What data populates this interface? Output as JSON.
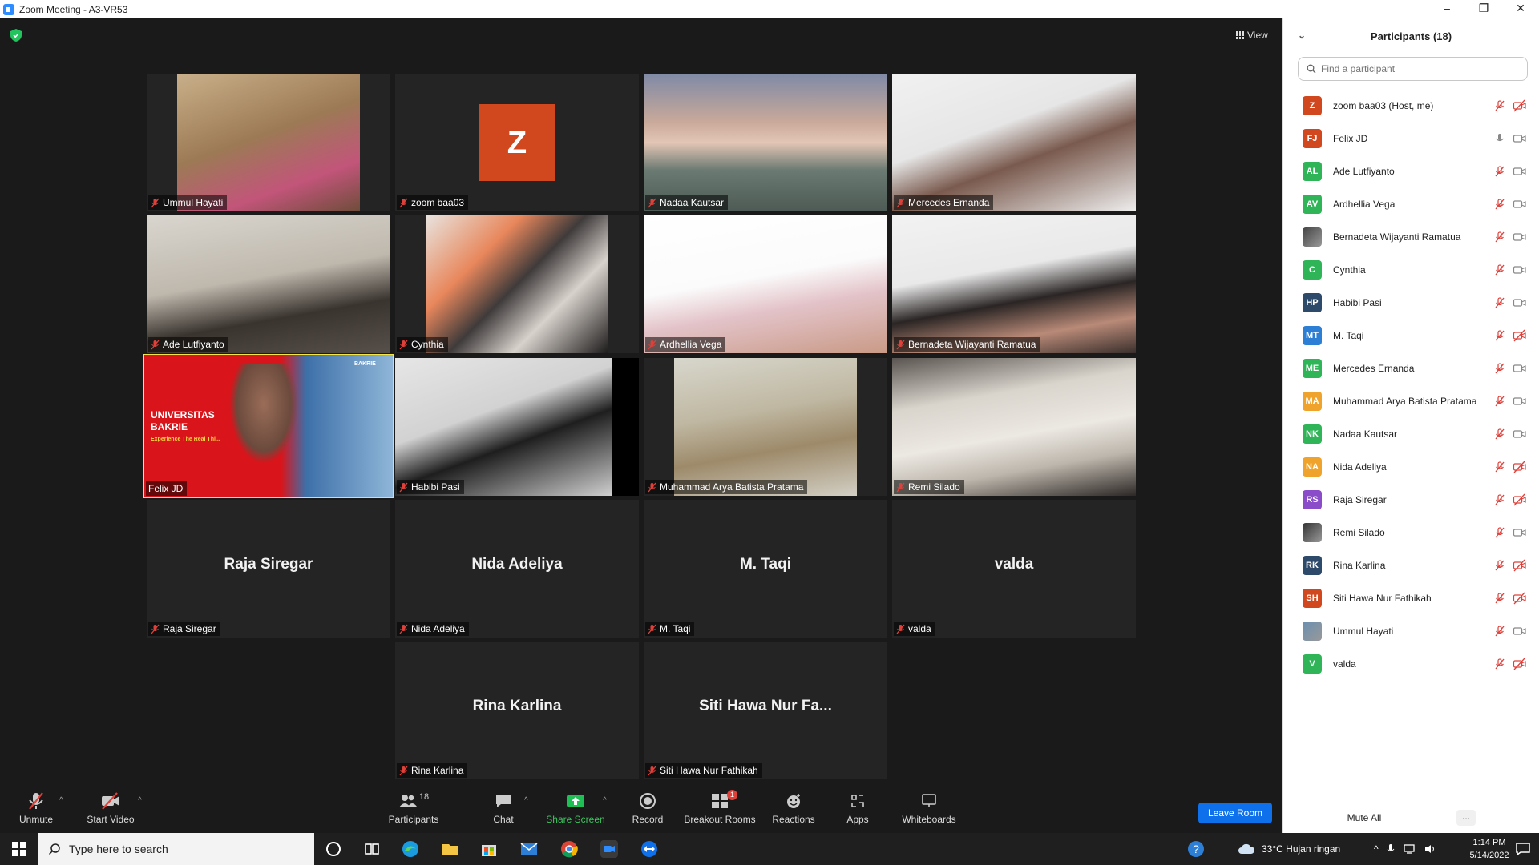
{
  "window": {
    "title": "Zoom Meeting - A3-VR53",
    "min": "–",
    "max": "❐",
    "close": "✕"
  },
  "view_label": "View",
  "tiles": [
    {
      "name": "Ummul Hayati",
      "video": true
    },
    {
      "name": "zoom baa03",
      "avatar_letter": "Z"
    },
    {
      "name": "Nadaa Kautsar",
      "video": true
    },
    {
      "name": "Mercedes Ernanda",
      "video": true
    },
    {
      "name": "Ade Lutfiyanto",
      "video": true
    },
    {
      "name": "Cynthia",
      "video": true
    },
    {
      "name": "Ardhellia Vega",
      "video": true
    },
    {
      "name": "Bernadeta Wijayanti Ramatua",
      "video": true
    },
    {
      "name": "Felix JD",
      "video": true,
      "active": true,
      "slide_title": "UNIVERSITAS BAKRIE",
      "slide_sub": "Experience The Real Thi...",
      "slide_logo": "BAKRIE"
    },
    {
      "name": "Habibi Pasi",
      "video": true
    },
    {
      "name": "Muhammad Arya Batista Pratama",
      "video": true
    },
    {
      "name": "Remi Silado",
      "video": true
    },
    {
      "name": "Raja Siregar",
      "display": "Raja Siregar"
    },
    {
      "name": "Nida Adeliya",
      "display": "Nida Adeliya"
    },
    {
      "name": "M. Taqi",
      "display": "M. Taqi"
    },
    {
      "name": "valda",
      "display": "valda"
    },
    {
      "name": "Rina Karlina",
      "display": "Rina Karlina"
    },
    {
      "name": "Siti Hawa Nur Fathikah",
      "display": "Siti Hawa Nur Fa..."
    }
  ],
  "toolbar": {
    "unmute": "Unmute",
    "start_video": "Start Video",
    "participants": "Participants",
    "participants_count": "18",
    "chat": "Chat",
    "share_screen": "Share Screen",
    "record": "Record",
    "breakout_rooms": "Breakout Rooms",
    "breakout_badge": "1",
    "reactions": "Reactions",
    "apps": "Apps",
    "whiteboards": "Whiteboards",
    "leave_room": "Leave Room"
  },
  "panel": {
    "title": "Participants (18)",
    "search_placeholder": "Find a participant",
    "mute_all": "Mute All",
    "more": "...",
    "participants": [
      {
        "initials": "Z",
        "name": "zoom baa03 (Host, me)",
        "color": "#d2481e",
        "mic": "off",
        "cam": "off"
      },
      {
        "initials": "FJ",
        "name": "Felix JD",
        "color": "#d2481e",
        "mic": "on",
        "cam": "on"
      },
      {
        "initials": "AL",
        "name": "Ade Lutfiyanto",
        "color": "#2fb457",
        "mic": "off",
        "cam": "on"
      },
      {
        "initials": "AV",
        "name": "Ardhellia Vega",
        "color": "#2fb457",
        "mic": "off",
        "cam": "on"
      },
      {
        "initials": "",
        "name": "Bernadeta Wijayanti Ramatua",
        "color": "#444444",
        "mic": "off",
        "cam": "on",
        "photo": true
      },
      {
        "initials": "C",
        "name": "Cynthia",
        "color": "#2fb457",
        "mic": "off",
        "cam": "on"
      },
      {
        "initials": "HP",
        "name": "Habibi Pasi",
        "color": "#2e4a6b",
        "mic": "off",
        "cam": "on"
      },
      {
        "initials": "MT",
        "name": "M. Taqi",
        "color": "#2d7fd6",
        "mic": "off",
        "cam": "off"
      },
      {
        "initials": "ME",
        "name": "Mercedes Ernanda",
        "color": "#2fb457",
        "mic": "off",
        "cam": "on"
      },
      {
        "initials": "MA",
        "name": "Muhammad Arya Batista Pratama",
        "color": "#f0a32c",
        "mic": "off",
        "cam": "on"
      },
      {
        "initials": "NK",
        "name": "Nadaa Kautsar",
        "color": "#2fb457",
        "mic": "off",
        "cam": "on"
      },
      {
        "initials": "NA",
        "name": "Nida Adeliya",
        "color": "#f0a32c",
        "mic": "off",
        "cam": "off"
      },
      {
        "initials": "RS",
        "name": "Raja Siregar",
        "color": "#8a4cc9",
        "mic": "off",
        "cam": "off"
      },
      {
        "initials": "",
        "name": "Remi Silado",
        "color": "#333333",
        "mic": "off",
        "cam": "on",
        "photo": true
      },
      {
        "initials": "RK",
        "name": "Rina Karlina",
        "color": "#2e4a6b",
        "mic": "off",
        "cam": "off"
      },
      {
        "initials": "SH",
        "name": "Siti Hawa Nur Fathikah",
        "color": "#d2481e",
        "mic": "off",
        "cam": "off"
      },
      {
        "initials": "",
        "name": "Ummul Hayati",
        "color": "#6a8fb0",
        "mic": "off",
        "cam": "on",
        "photo": true
      },
      {
        "initials": "V",
        "name": "valda",
        "color": "#2fb457",
        "mic": "off",
        "cam": "off"
      }
    ]
  },
  "taskbar": {
    "search_placeholder": "Type here to search",
    "weather": "33°C  Hujan ringan",
    "time": "1:14 PM",
    "date": "5/14/2022"
  },
  "colors": {
    "accent": "#0e71eb",
    "muted_red": "#e0403a",
    "share_green": "#40c463",
    "active_border": "#f5e542"
  }
}
